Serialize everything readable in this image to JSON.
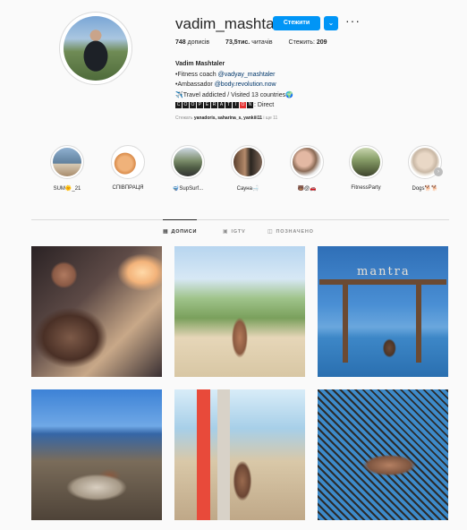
{
  "profile": {
    "username": "vadim_mashtaler",
    "follow_label": "Стежити",
    "more_icon": "chevron-down-icon",
    "options_icon": "more-horizontal-icon",
    "stats": {
      "posts_value": "748",
      "posts_label": "дописів",
      "followers_value": "73,5тис.",
      "followers_label": "читачів",
      "following_label": "Стежить:",
      "following_value": "209"
    },
    "bio": {
      "name": "Vadim Mashtaler",
      "line1_prefix": "•Fitness coach",
      "line1_link": "@vadyay_mashtaler",
      "line2_prefix": "•Ambassador",
      "line2_link": "@body.revolution.now",
      "line3": "✈️Travel addicted / Visited 13 countries🌍",
      "coop_letters": [
        "C",
        "O",
        "O",
        "P",
        "E",
        "R",
        "A",
        "T",
        "I",
        "O",
        "N"
      ],
      "coop_suffix": ": Direct"
    },
    "followed_by": {
      "prefix": "Стежать",
      "names": "yanadoris, saharina_s, yankiii11",
      "suffix": "і ще 11"
    }
  },
  "highlights": [
    {
      "label": "SUM🌞_21",
      "color": "#6d8fb1"
    },
    {
      "label": "СПІВПРАЦЯ",
      "color": "#e7b07a"
    },
    {
      "label": "🤿SupSurf...",
      "color": "#7b8d6a"
    },
    {
      "label": "Сауна🛁",
      "color": "#8a6a55"
    },
    {
      "label": "🐻@🚗",
      "color": "#b88a7a"
    },
    {
      "label": "FitnessParty",
      "color": "#9aa47a"
    },
    {
      "label": "Dogs🐕🐕",
      "color": "#c9b8a5"
    }
  ],
  "tabs": [
    {
      "label": "ДОПИСИ",
      "icon": "grid-icon",
      "active": true
    },
    {
      "label": "IGTV",
      "icon": "igtv-icon",
      "active": false
    },
    {
      "label": "ПОЗНАЧЕНО",
      "icon": "tagged-icon",
      "active": false
    }
  ],
  "posts": [
    {
      "id": "car",
      "mark": ""
    },
    {
      "id": "beach-house",
      "mark": ""
    },
    {
      "id": "swings",
      "mark": "mantra"
    },
    {
      "id": "rooftop",
      "mark": ""
    },
    {
      "id": "surfboards",
      "mark": ""
    },
    {
      "id": "net",
      "mark": ""
    }
  ],
  "colors": {
    "accent": "#0095f6",
    "link": "#00376b",
    "muted": "#8e8e8e"
  }
}
